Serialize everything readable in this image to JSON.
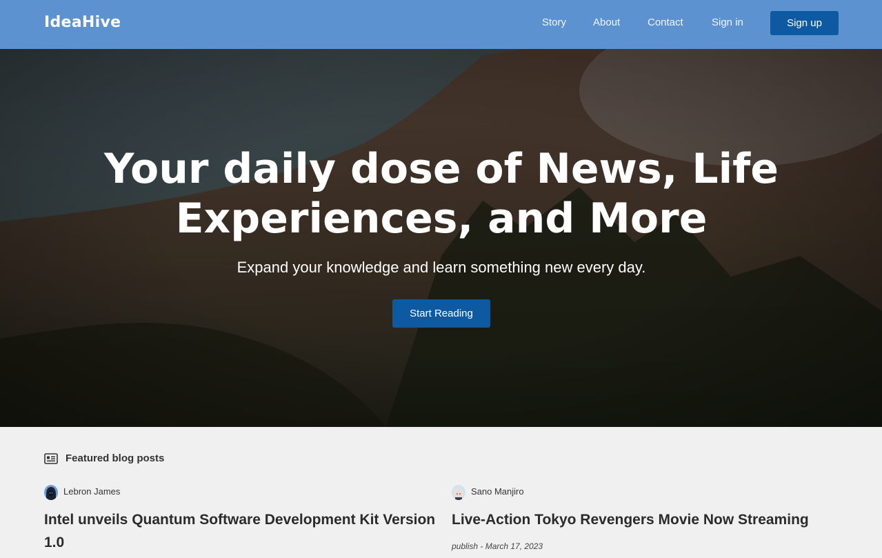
{
  "nav": {
    "brand": "IdeaHive",
    "links": [
      "Story",
      "About",
      "Contact",
      "Sign in"
    ],
    "signup": "Sign up"
  },
  "hero": {
    "title_line1": "Your daily dose of News, Life",
    "title_line2": "Experiences, and More",
    "subtitle": "Expand your knowledge and learn something new every day.",
    "cta": "Start Reading"
  },
  "featured": {
    "label": "Featured blog posts",
    "icon": "newspaper-icon"
  },
  "posts": [
    {
      "author": "Lebron James",
      "title": "Intel unveils Quantum Software Development Kit Version 1.0",
      "avatar_icon": "avatar-hooded-icon"
    },
    {
      "author": "Sano Manjiro",
      "title": "Live-Action Tokyo Revengers Movie Now Streaming",
      "publish": "publish - March 17, 2023",
      "avatar_icon": "avatar-anime-icon"
    }
  ],
  "colors": {
    "navbar": "#5b92cf",
    "button": "#0d5aa3",
    "page_bg": "#f0f0f0"
  }
}
